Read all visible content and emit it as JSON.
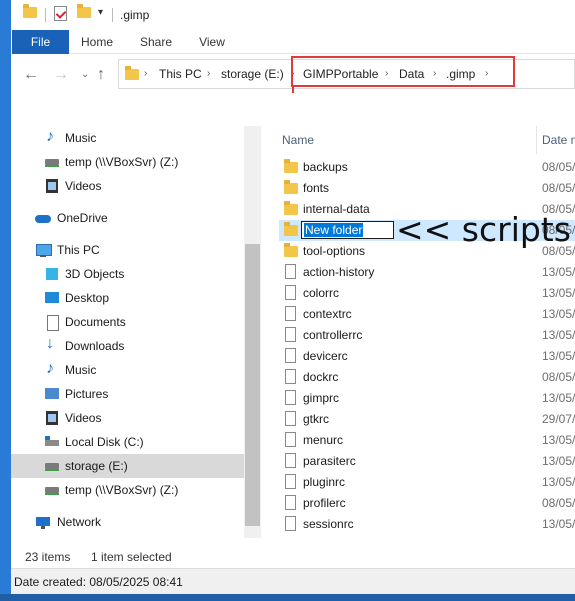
{
  "window": {
    "title": ".gimp"
  },
  "ribbon": {
    "tabs": [
      "File",
      "Home",
      "Share",
      "View"
    ]
  },
  "address": {
    "crumbs": [
      "This PC",
      "storage (E:)",
      "GIMPPortable",
      "Data",
      ".gimp"
    ],
    "chevron": "›"
  },
  "sidebar": {
    "items": [
      {
        "label": "Music",
        "icon": "music-icon"
      },
      {
        "label": "temp (\\\\VBoxSvr) (Z:)",
        "icon": "network-drive-icon"
      },
      {
        "label": "Videos",
        "icon": "videos-icon"
      },
      {
        "label": "OneDrive",
        "icon": "onedrive-icon"
      },
      {
        "label": "This PC",
        "icon": "this-pc-icon"
      },
      {
        "label": "3D Objects",
        "icon": "3d-objects-icon"
      },
      {
        "label": "Desktop",
        "icon": "desktop-icon"
      },
      {
        "label": "Documents",
        "icon": "documents-icon"
      },
      {
        "label": "Downloads",
        "icon": "downloads-icon"
      },
      {
        "label": "Music",
        "icon": "music-icon"
      },
      {
        "label": "Pictures",
        "icon": "pictures-icon"
      },
      {
        "label": "Videos",
        "icon": "videos-icon"
      },
      {
        "label": "Local Disk (C:)",
        "icon": "local-disk-icon"
      },
      {
        "label": "storage (E:)",
        "icon": "drive-icon",
        "selected": true
      },
      {
        "label": "temp (\\\\VBoxSvr) (Z:)",
        "icon": "network-drive-icon"
      },
      {
        "label": "Network",
        "icon": "network-icon"
      }
    ]
  },
  "filelist": {
    "columns": {
      "name": "Name",
      "date": "Date m"
    },
    "rows": [
      {
        "name": "backups",
        "date": "08/05/",
        "type": "folder"
      },
      {
        "name": "fonts",
        "date": "08/05/",
        "type": "folder"
      },
      {
        "name": "internal-data",
        "date": "08/05/",
        "type": "folder"
      },
      {
        "name": "New folder",
        "date": "08/05/",
        "type": "folder",
        "renaming": true
      },
      {
        "name": "tool-options",
        "date": "08/05/",
        "type": "folder"
      },
      {
        "name": "action-history",
        "date": "13/05/",
        "type": "file"
      },
      {
        "name": "colorrc",
        "date": "13/05/",
        "type": "file"
      },
      {
        "name": "contextrc",
        "date": "13/05/",
        "type": "file"
      },
      {
        "name": "controllerrc",
        "date": "13/05/",
        "type": "file"
      },
      {
        "name": "devicerc",
        "date": "13/05/",
        "type": "file"
      },
      {
        "name": "dockrc",
        "date": "08/05/",
        "type": "file"
      },
      {
        "name": "gimprc",
        "date": "13/05/",
        "type": "file"
      },
      {
        "name": "gtkrc",
        "date": "29/07/",
        "type": "file"
      },
      {
        "name": "menurc",
        "date": "13/05/",
        "type": "file"
      },
      {
        "name": "parasiterc",
        "date": "13/05/",
        "type": "file"
      },
      {
        "name": "pluginrc",
        "date": "13/05/",
        "type": "file"
      },
      {
        "name": "profilerc",
        "date": "08/05/",
        "type": "file"
      },
      {
        "name": "sessionrc",
        "date": "13/05/",
        "type": "file"
      }
    ]
  },
  "annotation": {
    "text": "<< scripts",
    "color": "#e23a3a"
  },
  "status": {
    "item_count": "23 items",
    "selected": "1 item selected"
  },
  "details": {
    "text": "Date created: 08/05/2025 08:41"
  },
  "colors": {
    "accent": "#1a62b8",
    "selection": "#cde8ff",
    "highlight": "#0078d7"
  }
}
